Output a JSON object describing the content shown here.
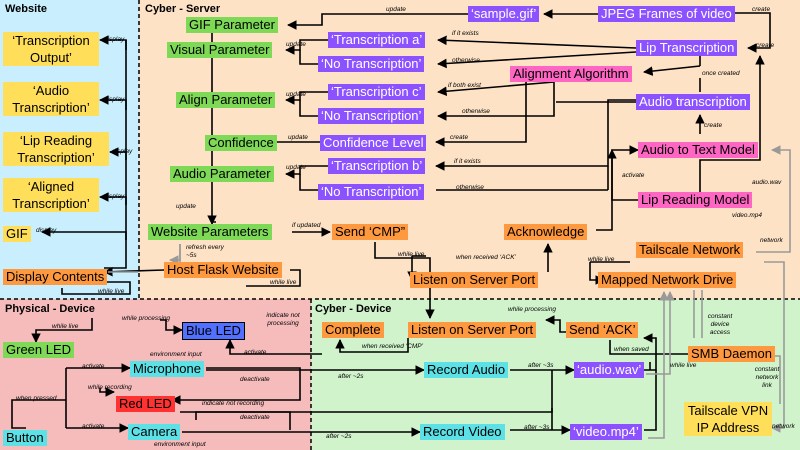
{
  "regions": {
    "website": "Website",
    "cyber_server": "Cyber - Server",
    "physical_device": "Physical - Device",
    "cyber_device": "Cyber - Device"
  },
  "website_nodes": {
    "transcription_output": "‘Transcription Output’",
    "audio_transcription": "‘Audio Transcription’",
    "lip_reading_transcription": "‘Lip Reading Transcription’",
    "aligned_transcription": "‘Aligned Transcription’",
    "gif": "GIF",
    "display_contents": "Display Contents"
  },
  "server_nodes": {
    "gif_parameter": "GIF Parameter",
    "sample_gif": "‘sample.gif’",
    "jpeg_frames": "JPEG Frames of video",
    "visual_parameter": "Visual Parameter",
    "transcription_a": "‘Transcription a’",
    "no_transcription_1": "‘No Transcription’",
    "lip_transcription": "Lip Transcription",
    "alignment_algorithm": "Alignment Algorithm",
    "align_parameter": "Align Parameter",
    "transcription_c": "‘Transcription c’",
    "no_transcription_2": "‘No Transcription’",
    "audio_transcription": "Audio transcription",
    "confidence": "Confidence",
    "confidence_level": "Confidence Level",
    "audio_to_text_model": "Audio to Text Model",
    "audio_parameter": "Audio Parameter",
    "transcription_b": "‘Transcription b’",
    "no_transcription_3": "‘No Transcription’",
    "lip_reading_model": "Lip Reading Model",
    "website_parameters": "Website Parameters",
    "send_cmp": "Send ‘CMP”",
    "acknowledge": "Acknowledge",
    "tailscale_network": "Tailscale Network",
    "host_flask_website": "Host Flask Website",
    "listen_server_port": "Listen on Server Port",
    "mapped_network_drive": "Mapped Network Drive"
  },
  "physical_nodes": {
    "green_led": "Green LED",
    "blue_led": "Blue LED",
    "microphone": "Microphone",
    "red_led": "Red LED",
    "button": "Button",
    "camera": "Camera"
  },
  "device_nodes": {
    "complete": "Complete",
    "listen_server_port": "Listen on Server Port",
    "send_ack": "Send ‘ACK’",
    "smb_daemon": "SMB Daemon",
    "record_audio": "Record Audio",
    "audio_wav": "‘audio.wav’",
    "record_video": "Record Video",
    "video_mp4": "‘video.mp4’",
    "tailscale_vpn": "Tailscale VPN IP Address"
  },
  "edge_labels": {
    "display_1": "display",
    "display_2": "display",
    "display_3": "display",
    "display_4": "display",
    "display_5": "display",
    "while_live_web": "while live",
    "update_gif": "update",
    "create_jpeg": "create",
    "if_it_exists_a": "if it exists",
    "otherwise_a": "otherwise",
    "update_visual": "update",
    "create_lip": "create",
    "once_created": "once created",
    "if_both_exist": "if both exist",
    "update_align": "update",
    "otherwise_c": "otherwise",
    "create_conf": "create",
    "update_conf": "update",
    "create_audio": "create",
    "if_it_exists_b": "if it exists",
    "otherwise_b": "otherwise",
    "update_audio": "update",
    "activate_model": "activate",
    "audio_wav_lbl": "audio.wav",
    "video_mp4_lbl": "video.mp4",
    "update_web": "update",
    "if_updated": "if updated",
    "refresh": "refresh every ~5s",
    "while_live_flask": "while live",
    "while_live_port": "while live",
    "when_received_ack": "when received ‘ACK’",
    "while_live_drive": "while live",
    "network_1": "network",
    "while_live_green": "while live",
    "while_processing_led": "while processing",
    "indicate_not_processing": "indicate not processing",
    "activate_blue": "activate",
    "environment_input_1": "environment input",
    "activate_mic": "activate",
    "deactivate_1": "deactivate",
    "while_recording": "while recording",
    "indicate_not_recording": "indicate not recording",
    "deactivate_2": "deactivate",
    "when_pressed": "when pressed",
    "activate_cam": "activate",
    "environment_input_2": "environment input",
    "while_processing_port": "while processing",
    "when_received_cmp": "when received ‘CMP’",
    "when_saved": "when saved",
    "constant_device_access": "constant device access",
    "while_live_smb": "while live",
    "after_2s_1": "after ~2s",
    "after_3s_1": "after ~3s",
    "constant_network_link": "constant network link",
    "after_2s_2": "after ~2s",
    "after_3s_2": "after ~3s",
    "network_2": "network"
  },
  "colors": {
    "website_bg": "#c9efff",
    "server_bg": "#fde2c6",
    "physical_bg": "#f6bcbc",
    "device_bg": "#d1f3cc"
  }
}
